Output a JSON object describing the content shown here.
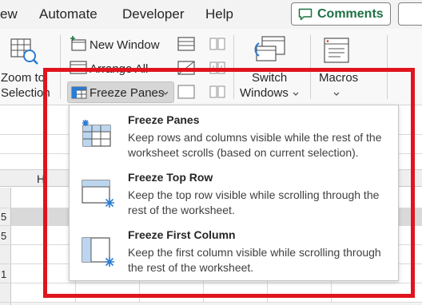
{
  "tabs": {
    "view": "ew",
    "automate": "Automate",
    "developer": "Developer",
    "help": "Help"
  },
  "comments_button": {
    "label": "Comments"
  },
  "ribbon": {
    "zoom_to_selection": [
      "Zoom to",
      "Selection"
    ],
    "new_window": "New Window",
    "arrange_all": "Arrange All",
    "freeze_panes": "Freeze Panes",
    "switch_windows": [
      "Switch",
      "Windows"
    ],
    "macros": "Macros"
  },
  "sheet": {
    "column_header_fragment": "H",
    "row_numbers": [
      "5",
      "5",
      "1"
    ]
  },
  "freeze_menu": {
    "items": [
      {
        "title": "Freeze Panes",
        "description": "Keep rows and columns visible while the rest of the worksheet scrolls (based on current selection)."
      },
      {
        "title": "Freeze Top Row",
        "description": "Keep the top row visible while scrolling through the rest of the worksheet."
      },
      {
        "title": "Freeze First Column",
        "description": "Keep the first column visible while scrolling through the rest of the worksheet."
      }
    ]
  },
  "colors": {
    "accent_green": "#1e7145",
    "icon_blue": "#2b7cd3",
    "annotation_red": "#e0141e"
  }
}
